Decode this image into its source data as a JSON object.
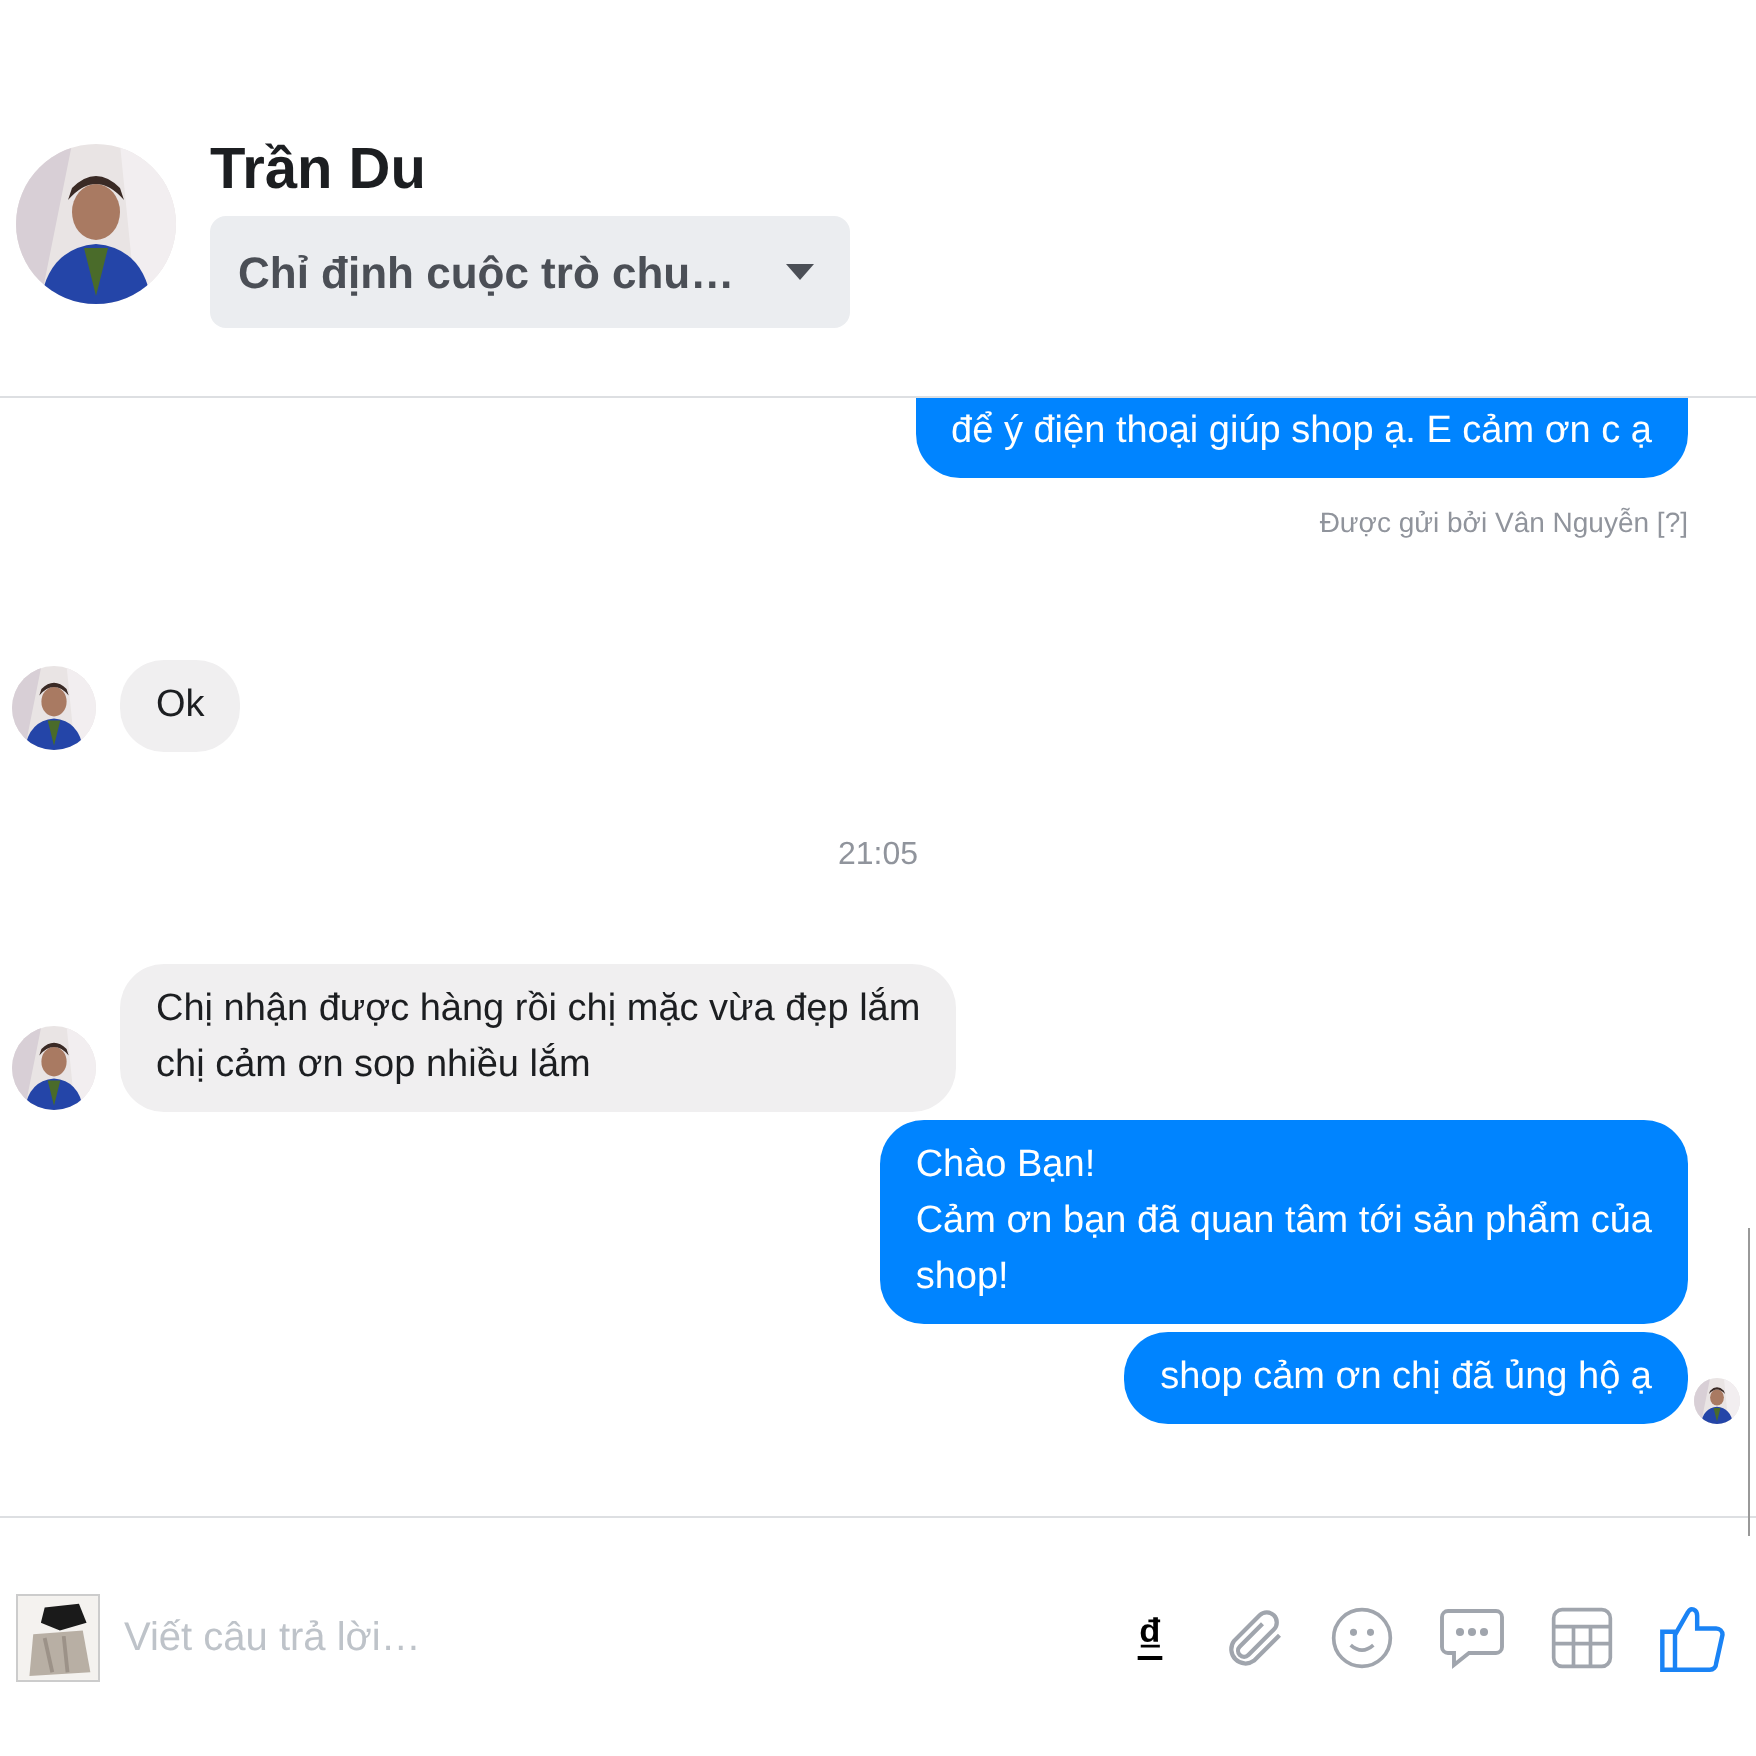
{
  "contact": {
    "name": "Trần Du"
  },
  "assign_dropdown": {
    "label": "Chỉ định cuộc trò chu…"
  },
  "messages": [
    {
      "kind": "outgoing",
      "text": "để ý điện thoại giúp shop ạ. E cảm ơn c ạ",
      "cut": true
    },
    {
      "kind": "sent_by",
      "text": "Được gửi bởi Vân Nguyễn [?]"
    },
    {
      "kind": "incoming",
      "text": "Ok"
    },
    {
      "kind": "timestamp",
      "text": "21:05"
    },
    {
      "kind": "incoming",
      "text": "Chị nhận được hàng rồi chị mặc vừa đẹp lắm\nchị cảm ơn sop nhiều lắm"
    },
    {
      "kind": "outgoing",
      "text": "Chào Bạn!\nCảm ơn bạn đã quan tâm tới sản phẩm của\nshop!",
      "cut": false
    },
    {
      "kind": "outgoing",
      "text": "shop cảm ơn chị đã ủng hộ ạ",
      "cut": false,
      "seen": true
    }
  ],
  "composer": {
    "placeholder": "Viết câu trả lời…",
    "currency_symbol": "₫"
  }
}
